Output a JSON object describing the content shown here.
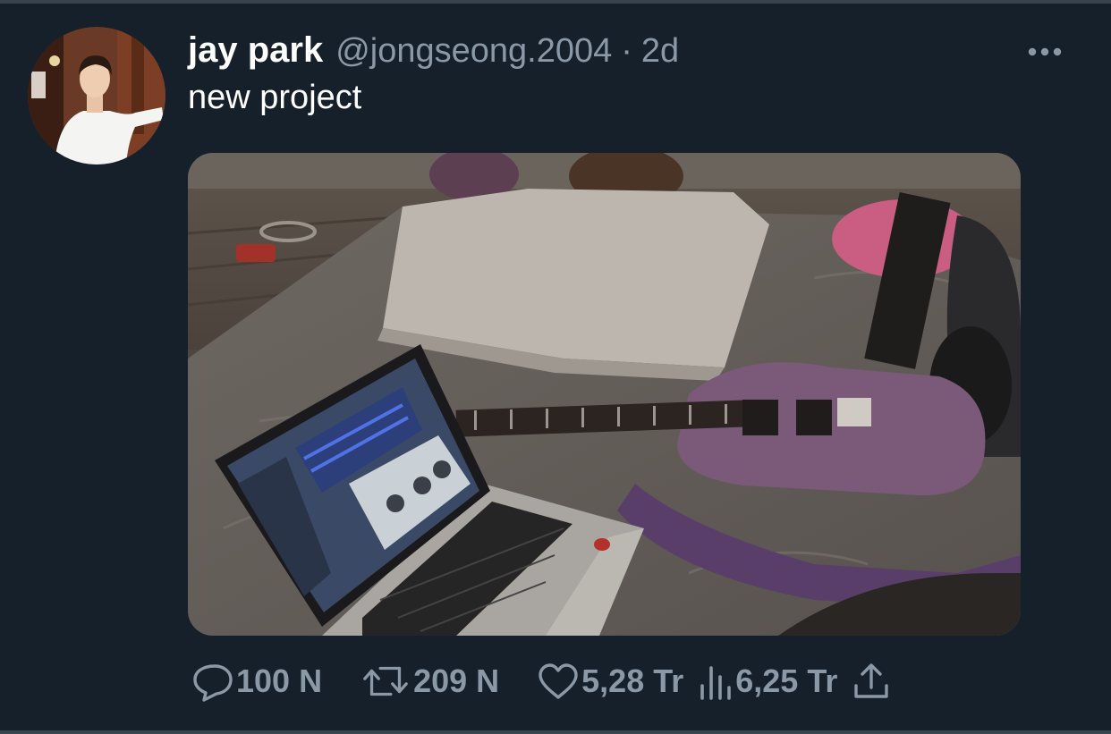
{
  "tweet": {
    "author": {
      "name": "jay park",
      "handle": "@jongseong.2004",
      "avatar_icon": "user-avatar"
    },
    "separator": "·",
    "time": "2d",
    "text": "new project",
    "more_icon": "more-horizontal-icon"
  },
  "actions": {
    "reply": {
      "icon": "reply-icon",
      "count": "100 N"
    },
    "retweet": {
      "icon": "retweet-icon",
      "count": "209 N"
    },
    "like": {
      "icon": "heart-icon",
      "count": "5,28 Tr"
    },
    "views": {
      "icon": "views-icon",
      "count": "6,25 Tr"
    },
    "share": {
      "icon": "share-icon"
    }
  },
  "colors": {
    "background": "#15202b",
    "divider": "#38444d",
    "primary_text": "#ffffff",
    "secondary_text": "#8b98a5"
  }
}
